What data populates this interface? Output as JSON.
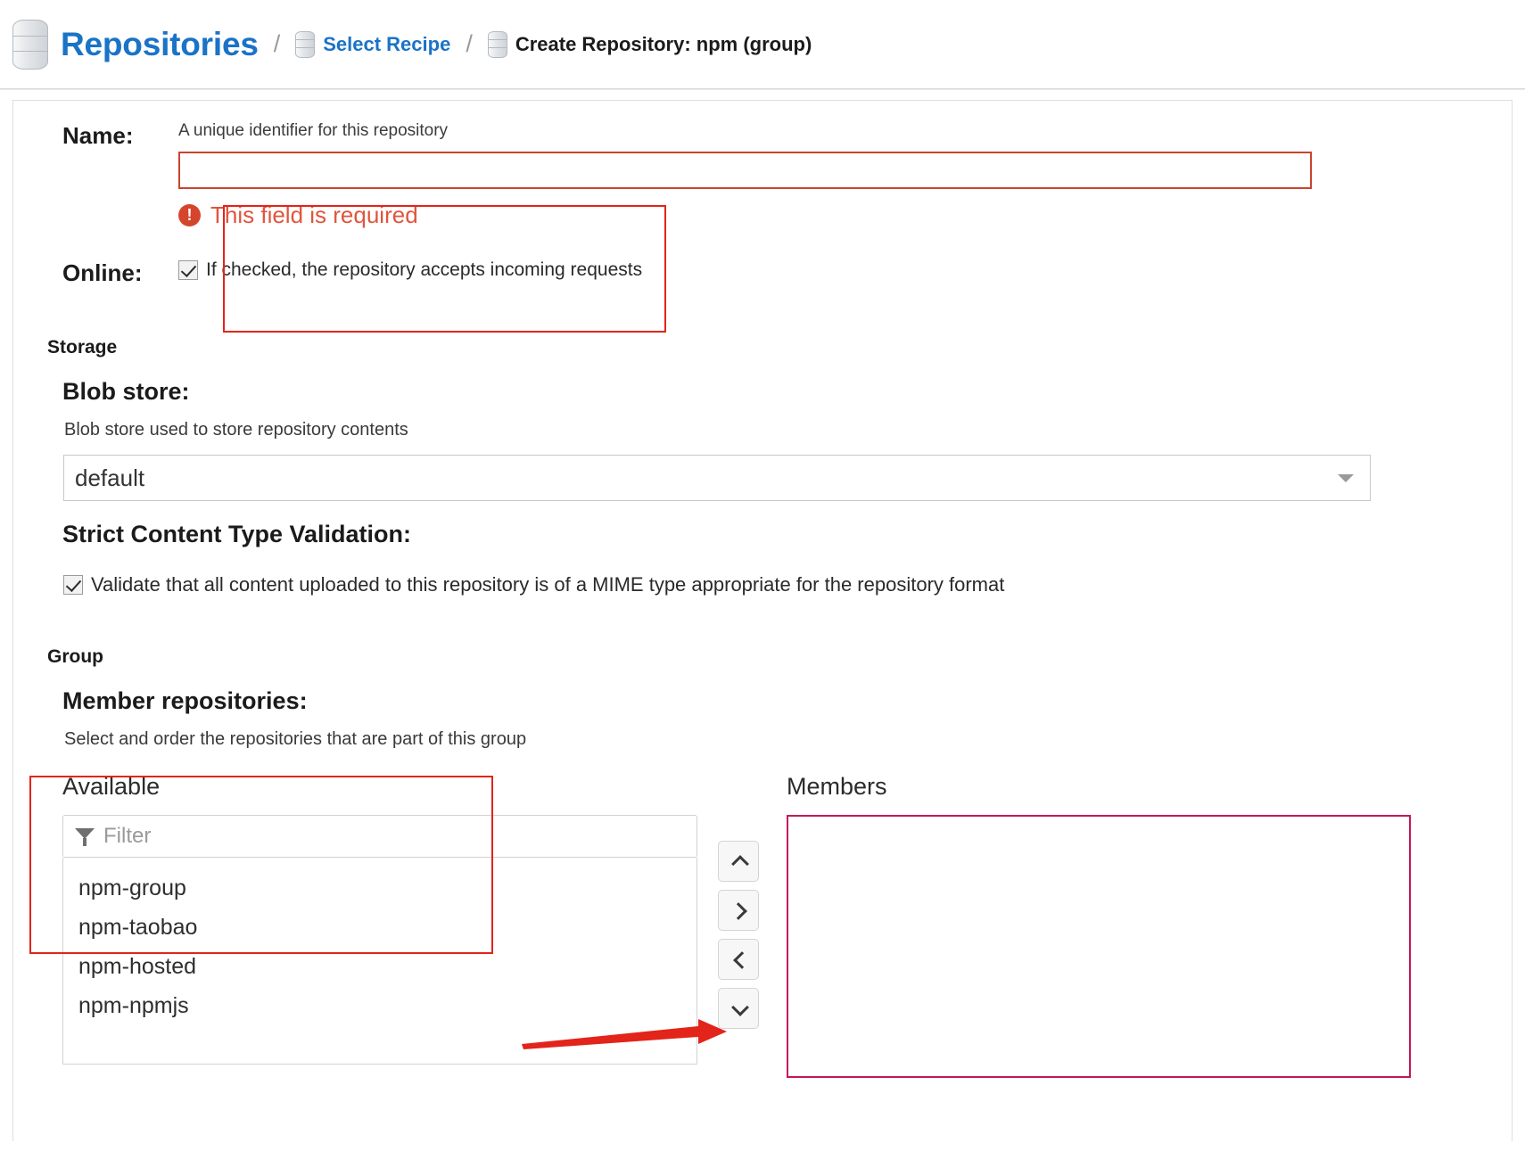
{
  "breadcrumb": {
    "root_label": "Repositories",
    "sep": "/",
    "recipe_label": "Select Recipe",
    "current_label": "Create Repository: npm (group)",
    "root_icon": "database-icon",
    "recipe_icon": "database-icon",
    "current_icon": "database-icon"
  },
  "form": {
    "name": {
      "label": "Name:",
      "hint": "A unique identifier for this repository",
      "value": "",
      "placeholder": "",
      "error": "This field is required",
      "error_icon": "!"
    },
    "online": {
      "label": "Online:",
      "checkbox_label": "If checked, the repository accepts incoming requests",
      "checked": true
    },
    "storage": {
      "section_label": "Storage",
      "blob_store_label": "Blob store:",
      "blob_store_hint": "Blob store used to store repository contents",
      "blob_store_value": "default",
      "blob_store_caret": "chevron-down-icon",
      "strict_label": "Strict Content Type Validation:",
      "strict_checkbox_label": "Validate that all content uploaded to this repository is of a MIME type appropriate for the repository format",
      "strict_checked": true
    },
    "group": {
      "section_label": "Group",
      "members_label": "Member repositories:",
      "members_hint": "Select and order the repositories that are part of this group",
      "available_header": "Available",
      "members_header": "Members",
      "filter_placeholder": "Filter",
      "filter_value": "",
      "filter_icon": "funnel-icon",
      "available_items": [
        "npm-group",
        "npm-taobao",
        "npm-hosted",
        "npm-npmjs"
      ],
      "member_items": [],
      "transfer_buttons": [
        {
          "name": "move-up-button",
          "icon": "chevron-up-icon"
        },
        {
          "name": "move-right-button",
          "icon": "chevron-right-icon"
        },
        {
          "name": "move-left-button",
          "icon": "chevron-left-icon"
        },
        {
          "name": "move-down-button",
          "icon": "chevron-down-icon"
        }
      ]
    }
  },
  "annotations": {
    "name_box_color": "#e2241a",
    "available_box_color": "#e2241a",
    "members_box_color": "#c2185b",
    "arrow_color": "#e2241a",
    "error_color": "#e0553c",
    "accent_color": "#1a73c7"
  }
}
